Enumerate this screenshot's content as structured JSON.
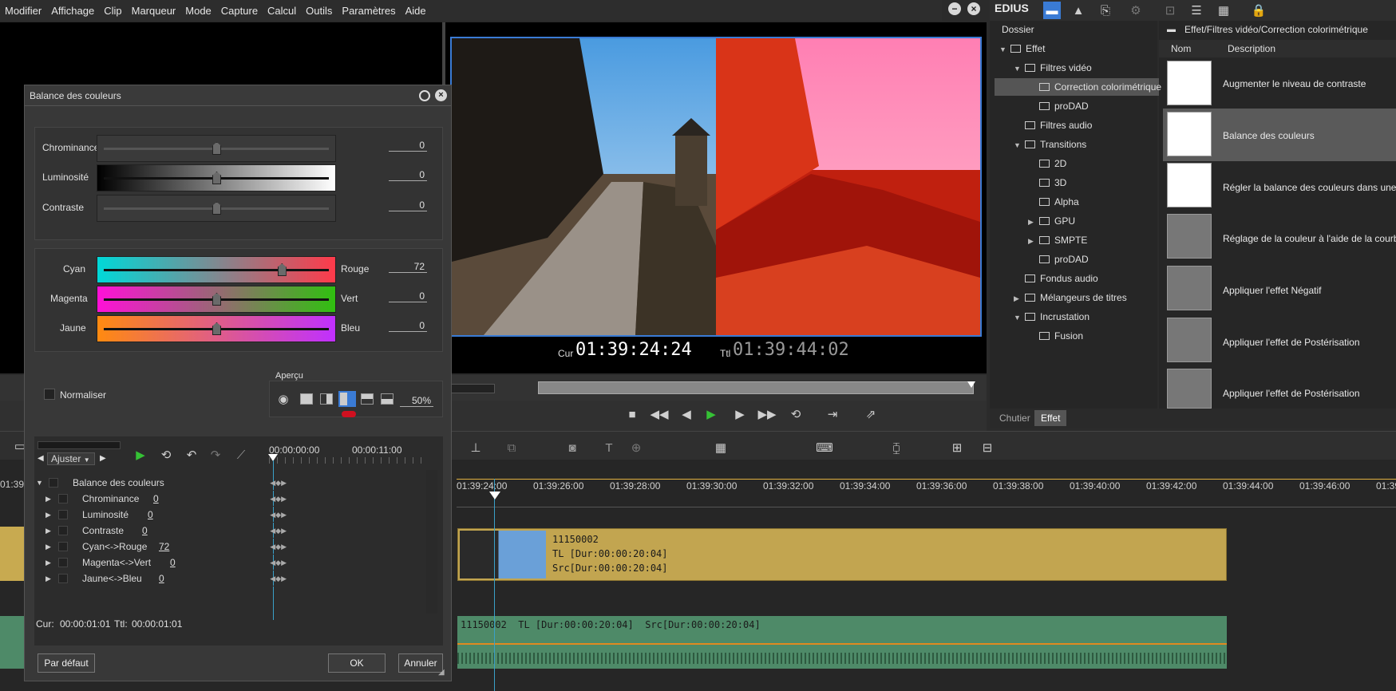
{
  "menu": [
    "Modifier",
    "Affichage",
    "Clip",
    "Marqueur",
    "Mode",
    "Capture",
    "Calcul",
    "Outils",
    "Paramètres",
    "Aide"
  ],
  "app_name": "EDIUS",
  "player": {
    "cur_label": "Cur",
    "cur_tc": "01:39:24:24",
    "ttl_label": "Ttl",
    "ttl_tc": "01:39:44:02"
  },
  "palette": {
    "folder_header": "Dossier",
    "path": "Effet/Filtres vidéo/Correction colorimétrique",
    "col_name": "Nom",
    "col_desc": "Description",
    "tree": [
      {
        "label": "Effet",
        "depth": 0,
        "exp": "▼"
      },
      {
        "label": "Filtres vidéo",
        "depth": 1,
        "exp": "▼"
      },
      {
        "label": "Correction colorimétrique",
        "depth": 2,
        "exp": "",
        "selected": true
      },
      {
        "label": "proDAD",
        "depth": 2,
        "exp": ""
      },
      {
        "label": "Filtres audio",
        "depth": 1,
        "exp": ""
      },
      {
        "label": "Transitions",
        "depth": 1,
        "exp": "▼"
      },
      {
        "label": "2D",
        "depth": 2,
        "exp": ""
      },
      {
        "label": "3D",
        "depth": 2,
        "exp": ""
      },
      {
        "label": "Alpha",
        "depth": 2,
        "exp": ""
      },
      {
        "label": "GPU",
        "depth": 2,
        "exp": "▶"
      },
      {
        "label": "SMPTE",
        "depth": 2,
        "exp": "▶"
      },
      {
        "label": "proDAD",
        "depth": 2,
        "exp": ""
      },
      {
        "label": "Fondus audio",
        "depth": 1,
        "exp": ""
      },
      {
        "label": "Mélangeurs de titres",
        "depth": 1,
        "exp": "▶"
      },
      {
        "label": "Incrustation",
        "depth": 1,
        "exp": "▼"
      },
      {
        "label": "Fusion",
        "depth": 2,
        "exp": ""
      }
    ],
    "effects": [
      "Augmenter le niveau de contraste",
      "Balance des couleurs",
      "Régler la balance des couleurs dans une imag",
      "Réglage de la couleur à l'aide de la courbe YU",
      "Appliquer l'effet Négatif",
      "Appliquer l'effet de Postérisation",
      "Appliquer l'effet de Postérisation"
    ],
    "tab_bin": "Chutier",
    "tab_effect": "Effet"
  },
  "dialog": {
    "title": "Balance des couleurs",
    "chrominance_label": "Chrominance",
    "chrominance_val": "0",
    "luminosite_label": "Luminosité",
    "luminosite_val": "0",
    "contraste_label": "Contraste",
    "contraste_val": "0",
    "cyan_label": "Cyan",
    "rouge_label": "Rouge",
    "cyan_rouge_val": "72",
    "magenta_label": "Magenta",
    "vert_label": "Vert",
    "magenta_vert_val": "0",
    "jaune_label": "Jaune",
    "bleu_label": "Bleu",
    "jaune_bleu_val": "0",
    "normaliser": "Normaliser",
    "apercu": "Aperçu",
    "apercu_pct": "50%",
    "ajuster": "Ajuster",
    "kf_tc_start": "00:00:00:00",
    "kf_tc_mid": "00:00:11:00",
    "params": [
      {
        "label": "Balance des couleurs",
        "val": ""
      },
      {
        "label": "Chrominance",
        "val": "0"
      },
      {
        "label": "Luminosité",
        "val": "0"
      },
      {
        "label": "Contraste",
        "val": "0"
      },
      {
        "label": "Cyan<->Rouge",
        "val": "72"
      },
      {
        "label": "Magenta<->Vert",
        "val": "0"
      },
      {
        "label": "Jaune<->Bleu",
        "val": "0"
      }
    ],
    "cur_label": "Cur:",
    "cur_val": "00:00:01:01",
    "ttl_label": "Ttl:",
    "ttl_val": "00:00:01:01",
    "default_btn": "Par défaut",
    "ok_btn": "OK",
    "cancel_btn": "Annuler"
  },
  "timeline": {
    "left_tc": "01:39",
    "ruler": [
      "01:39:24:00",
      "01:39:26:00",
      "01:39:28:00",
      "01:39:30:00",
      "01:39:32:00",
      "01:39:34:00",
      "01:39:36:00",
      "01:39:38:00",
      "01:39:40:00",
      "01:39:42:00",
      "01:39:44:00",
      "01:39:46:00",
      "01:39"
    ],
    "clip_name": "11150002",
    "clip_tl": "TL [Dur:00:00:20:04]",
    "clip_src": "Src[Dur:00:00:20:04]",
    "audio_label": "11150002  TL [Dur:00:00:20:04]  Src[Dur:00:00:20:04]"
  },
  "slider_levels": {
    "chrominance": 0.5,
    "luminosite": 0.5,
    "contraste": 0.5,
    "cyan_rouge": 0.79,
    "magenta_vert": 0.5,
    "jaune_bleu": 0.5
  }
}
